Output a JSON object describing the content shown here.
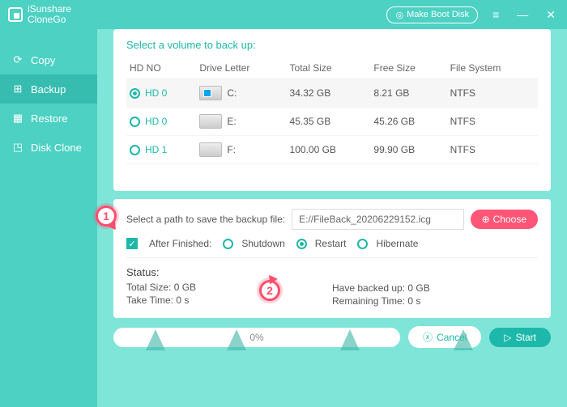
{
  "app": {
    "name1": "iSunshare",
    "name2": "CloneGo"
  },
  "titlebar": {
    "boot": "Make Boot Disk"
  },
  "sidebar": {
    "items": [
      {
        "label": "Copy"
      },
      {
        "label": "Backup"
      },
      {
        "label": "Restore"
      },
      {
        "label": "Disk Clone"
      }
    ]
  },
  "volumes": {
    "title": "Select a volume to back up:",
    "headers": {
      "hdno": "HD NO",
      "letter": "Drive Letter",
      "total": "Total Size",
      "free": "Free Size",
      "fs": "File System"
    },
    "rows": [
      {
        "hdno": "HD 0",
        "letter": "C:",
        "total": "34.32 GB",
        "free": "8.21 GB",
        "fs": "NTFS",
        "selected": true,
        "os": true
      },
      {
        "hdno": "HD 0",
        "letter": "E:",
        "total": "45.35 GB",
        "free": "45.26 GB",
        "fs": "NTFS",
        "selected": false
      },
      {
        "hdno": "HD 1",
        "letter": "F:",
        "total": "100.00 GB",
        "free": "99.90 GB",
        "fs": "NTFS",
        "selected": false
      }
    ]
  },
  "path": {
    "label": "Select a path to save the backup file:",
    "value": "E://FileBack_20206229152.icg",
    "choose": "Choose"
  },
  "after": {
    "label": "After Finished:",
    "options": {
      "shutdown": "Shutdown",
      "restart": "Restart",
      "hibernate": "Hibernate"
    },
    "selected": "restart"
  },
  "status": {
    "title": "Status:",
    "total": "Total Size: 0 GB",
    "take": "Take Time: 0 s",
    "backed": "Have backed up: 0 GB",
    "remain": "Remaining Time: 0 s"
  },
  "bottom": {
    "progress": "0%",
    "cancel": "Cancel",
    "start": "Start"
  },
  "annotations": {
    "b1": "1",
    "b2": "2"
  }
}
